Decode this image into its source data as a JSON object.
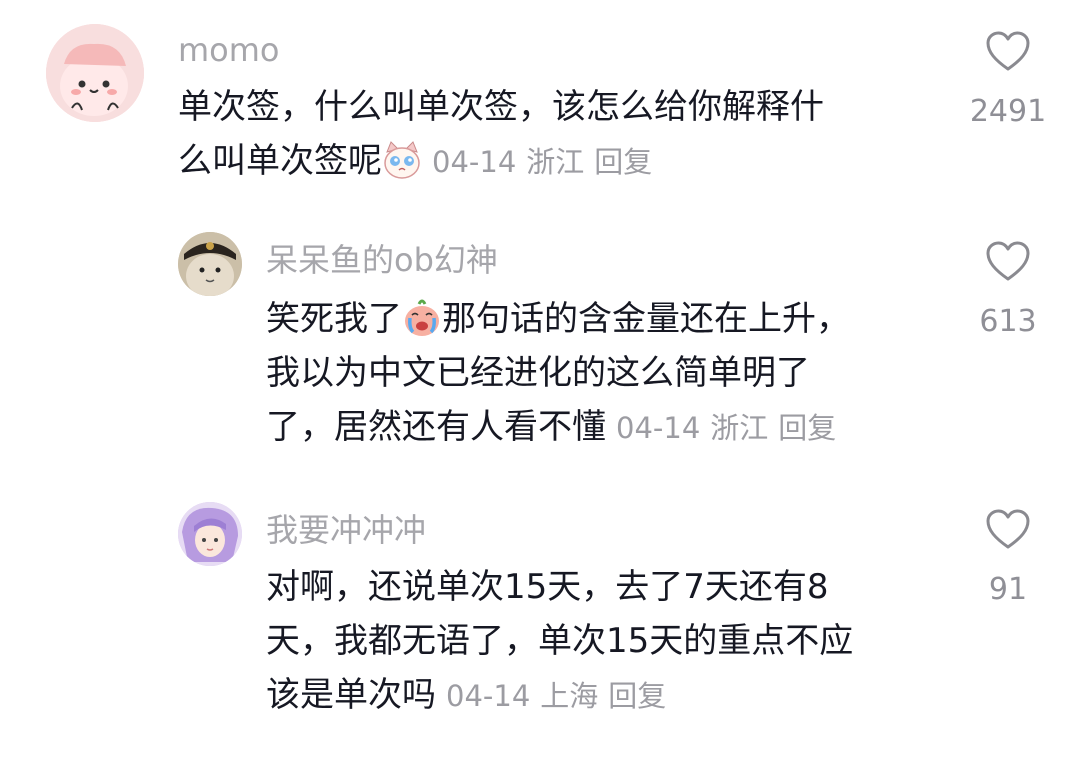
{
  "comments": [
    {
      "username": "momo",
      "text_line1": "单次签，什么叫单次签，该怎么给你解释什",
      "text_line2": "么叫单次签呢",
      "date": "04-14",
      "location": "浙江",
      "reply_label": "回复",
      "likes": "2491",
      "emoji": "crying-cat-emoji"
    },
    {
      "username": "呆呆鱼的ob幻神",
      "text_part1": "笑死我了",
      "text_part2": "那句话的含金量还在上升，",
      "text_line2": "我以为中文已经进化的这么简单明了",
      "text_line3": "了，居然还有人看不懂",
      "date": "04-14",
      "location": "浙江",
      "reply_label": "回复",
      "likes": "613",
      "emoji": "crying-face-emoji"
    },
    {
      "username": "我要冲冲冲",
      "text_line1": "对啊，还说单次15天，去了7天还有8",
      "text_line2": "天，我都无语了，单次15天的重点不应",
      "text_line3": "该是单次吗",
      "date": "04-14",
      "location": "上海",
      "reply_label": "回复",
      "likes": "91"
    }
  ],
  "colors": {
    "text": "#161823",
    "username": "#a6a6ab",
    "meta": "#9c9ca2"
  }
}
